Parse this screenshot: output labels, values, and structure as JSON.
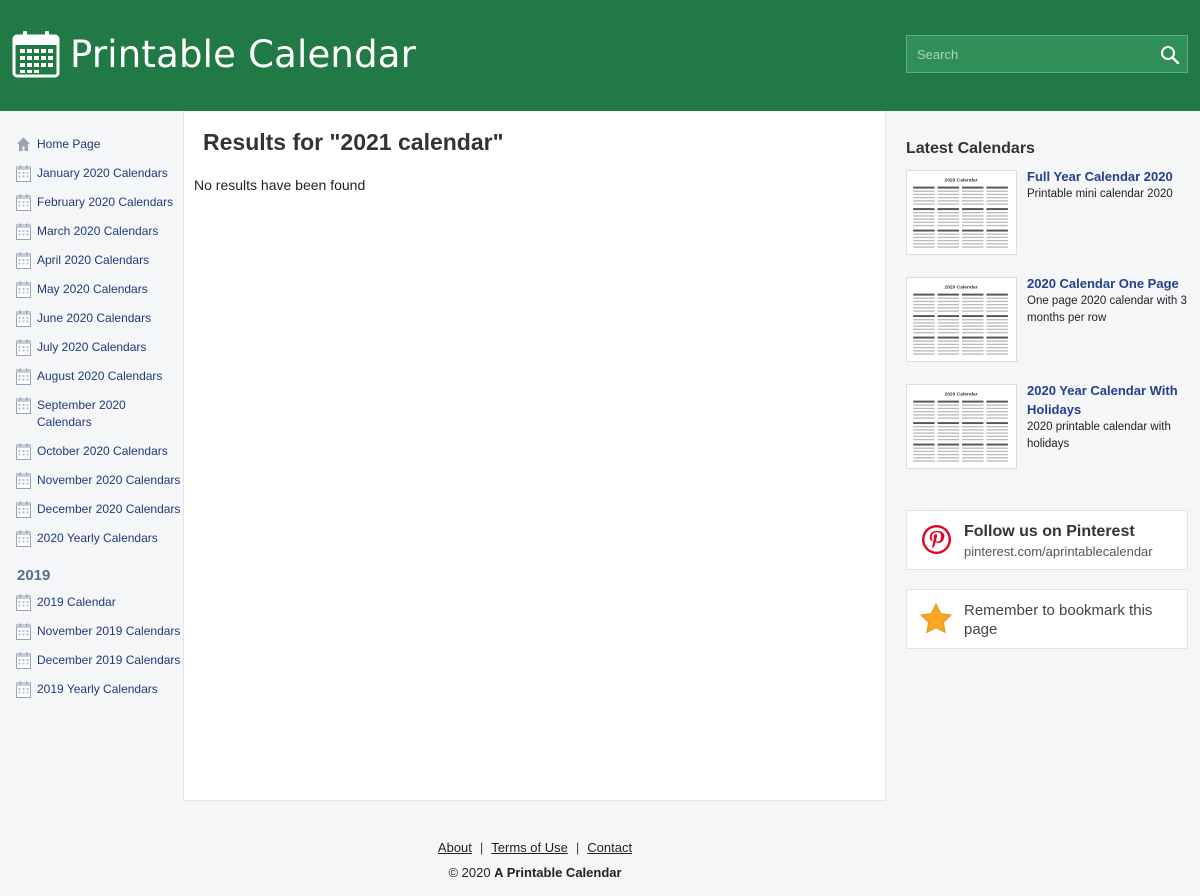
{
  "header": {
    "site_title": "Printable Calendar",
    "search_placeholder": "Search",
    "brand_color": "#217a45"
  },
  "leftnav": {
    "items": [
      {
        "label": "Home Page",
        "icon": "home-icon"
      },
      {
        "label": "January 2020 Calendars",
        "icon": "calendar-icon"
      },
      {
        "label": "February 2020 Calendars",
        "icon": "calendar-icon"
      },
      {
        "label": "March 2020 Calendars",
        "icon": "calendar-icon"
      },
      {
        "label": "April 2020 Calendars",
        "icon": "calendar-icon"
      },
      {
        "label": "May 2020 Calendars",
        "icon": "calendar-icon"
      },
      {
        "label": "June 2020 Calendars",
        "icon": "calendar-icon"
      },
      {
        "label": "July 2020 Calendars",
        "icon": "calendar-icon"
      },
      {
        "label": "August 2020 Calendars",
        "icon": "calendar-icon"
      },
      {
        "label": "September 2020 Calendars",
        "icon": "calendar-icon"
      },
      {
        "label": "October 2020 Calendars",
        "icon": "calendar-icon"
      },
      {
        "label": "November 2020 Calendars",
        "icon": "calendar-icon"
      },
      {
        "label": "December 2020 Calendars",
        "icon": "calendar-icon"
      },
      {
        "label": "2020 Yearly Calendars",
        "icon": "calendar-icon"
      }
    ],
    "heading_2019": "2019",
    "items_2019": [
      {
        "label": "2019 Calendar",
        "icon": "calendar-icon"
      },
      {
        "label": "November 2019 Calendars",
        "icon": "calendar-icon"
      },
      {
        "label": "December 2019 Calendars",
        "icon": "calendar-icon"
      },
      {
        "label": "2019 Yearly Calendars",
        "icon": "calendar-icon"
      }
    ]
  },
  "main": {
    "title": "Results for \"2021 calendar\"",
    "no_results": "No results have been found"
  },
  "sidebar": {
    "heading": "Latest Calendars",
    "items": [
      {
        "title": "Full Year Calendar 2020",
        "desc": "Printable mini calendar 2020",
        "thumb_title": "2020 Calendar"
      },
      {
        "title": "2020 Calendar One Page",
        "desc": "One page 2020 calendar with 3 months per row",
        "thumb_title": "2020 Calendar"
      },
      {
        "title": "2020 Year Calendar With Holidays",
        "desc": "2020 printable calendar with holidays",
        "thumb_title": "2020 Calendar"
      }
    ],
    "pinterest": {
      "title": "Follow us on Pinterest",
      "url": "pinterest.com/aprintablecalendar"
    },
    "bookmark": {
      "text": "Remember to bookmark this page"
    }
  },
  "footer": {
    "links": [
      "About",
      "Terms of Use",
      "Contact"
    ],
    "copyright_prefix": "© 2020 ",
    "copyright_name": "A Printable Calendar"
  }
}
